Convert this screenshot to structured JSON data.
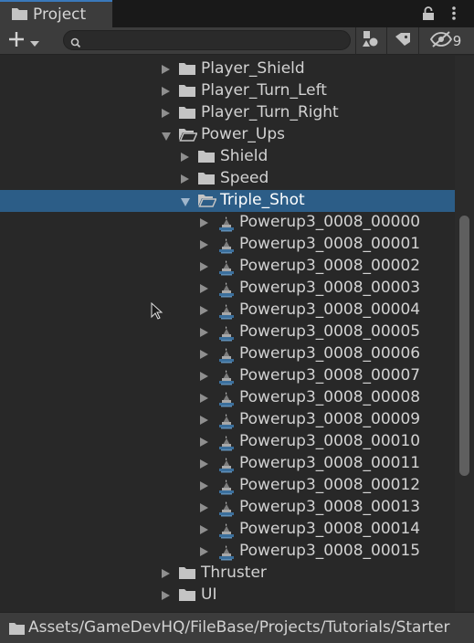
{
  "window": {
    "tab_label": "Project",
    "tab_icon": "folder-icon"
  },
  "toolbar": {
    "create_icon": "plus-icon",
    "search_value": "",
    "hidden_count": "9"
  },
  "tree": {
    "rows": [
      {
        "label": "Player_Shield",
        "kind": "folder",
        "expanded": false,
        "indent": 0
      },
      {
        "label": "Player_Turn_Left",
        "kind": "folder",
        "expanded": false,
        "indent": 0
      },
      {
        "label": "Player_Turn_Right",
        "kind": "folder",
        "expanded": false,
        "indent": 0
      },
      {
        "label": "Power_Ups",
        "kind": "folder-open",
        "expanded": true,
        "indent": 0
      },
      {
        "label": "Shield",
        "kind": "folder",
        "expanded": false,
        "indent": 1
      },
      {
        "label": "Speed",
        "kind": "folder",
        "expanded": false,
        "indent": 1
      },
      {
        "label": "Triple_Shot",
        "kind": "folder-open",
        "expanded": true,
        "indent": 1,
        "selected": true
      },
      {
        "label": "Powerup3_0008_00000",
        "kind": "sprite",
        "expanded": false,
        "indent": 2
      },
      {
        "label": "Powerup3_0008_00001",
        "kind": "sprite",
        "expanded": false,
        "indent": 2
      },
      {
        "label": "Powerup3_0008_00002",
        "kind": "sprite",
        "expanded": false,
        "indent": 2
      },
      {
        "label": "Powerup3_0008_00003",
        "kind": "sprite",
        "expanded": false,
        "indent": 2
      },
      {
        "label": "Powerup3_0008_00004",
        "kind": "sprite",
        "expanded": false,
        "indent": 2
      },
      {
        "label": "Powerup3_0008_00005",
        "kind": "sprite",
        "expanded": false,
        "indent": 2
      },
      {
        "label": "Powerup3_0008_00006",
        "kind": "sprite",
        "expanded": false,
        "indent": 2
      },
      {
        "label": "Powerup3_0008_00007",
        "kind": "sprite",
        "expanded": false,
        "indent": 2
      },
      {
        "label": "Powerup3_0008_00008",
        "kind": "sprite",
        "expanded": false,
        "indent": 2
      },
      {
        "label": "Powerup3_0008_00009",
        "kind": "sprite",
        "expanded": false,
        "indent": 2
      },
      {
        "label": "Powerup3_0008_00010",
        "kind": "sprite",
        "expanded": false,
        "indent": 2
      },
      {
        "label": "Powerup3_0008_00011",
        "kind": "sprite",
        "expanded": false,
        "indent": 2
      },
      {
        "label": "Powerup3_0008_00012",
        "kind": "sprite",
        "expanded": false,
        "indent": 2
      },
      {
        "label": "Powerup3_0008_00013",
        "kind": "sprite",
        "expanded": false,
        "indent": 2
      },
      {
        "label": "Powerup3_0008_00014",
        "kind": "sprite",
        "expanded": false,
        "indent": 2
      },
      {
        "label": "Powerup3_0008_00015",
        "kind": "sprite",
        "expanded": false,
        "indent": 2
      },
      {
        "label": "Thruster",
        "kind": "folder",
        "expanded": false,
        "indent": 0
      },
      {
        "label": "UI",
        "kind": "folder",
        "expanded": false,
        "indent": 0
      }
    ]
  },
  "statusbar": {
    "path": "Assets/GameDevHQ/FileBase/Projects/Tutorials/Starter"
  },
  "colors": {
    "panel_bg": "#282828",
    "toolbar_bg": "#3c3c3c",
    "selection": "#2c5d87",
    "accent": "#3a79bb"
  }
}
